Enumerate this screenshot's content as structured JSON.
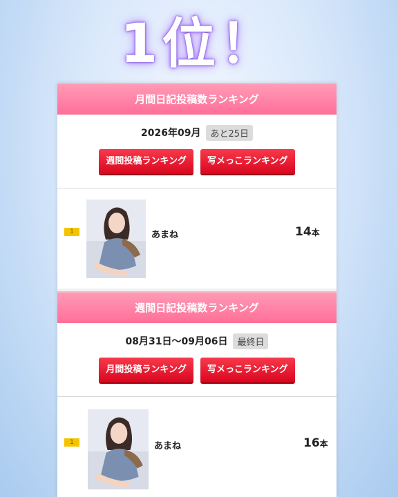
{
  "headline": "1位！",
  "monthly": {
    "header": "月間日記投稿数ランキング",
    "date": "2026年09月",
    "remaining": "あと25日",
    "buttons": [
      "週間投稿ランキング",
      "写メっこランキング"
    ],
    "entry": {
      "rank": "1",
      "name": "あまね",
      "count": "14",
      "unit": "本"
    }
  },
  "weekly": {
    "header": "週間日記投稿数ランキング",
    "date": "08月31日〜09月06日",
    "remaining": "最終日",
    "buttons": [
      "月間投稿ランキング",
      "写メっこランキング"
    ],
    "entry": {
      "rank": "1",
      "name": "あまね",
      "count": "16",
      "unit": "本"
    }
  }
}
